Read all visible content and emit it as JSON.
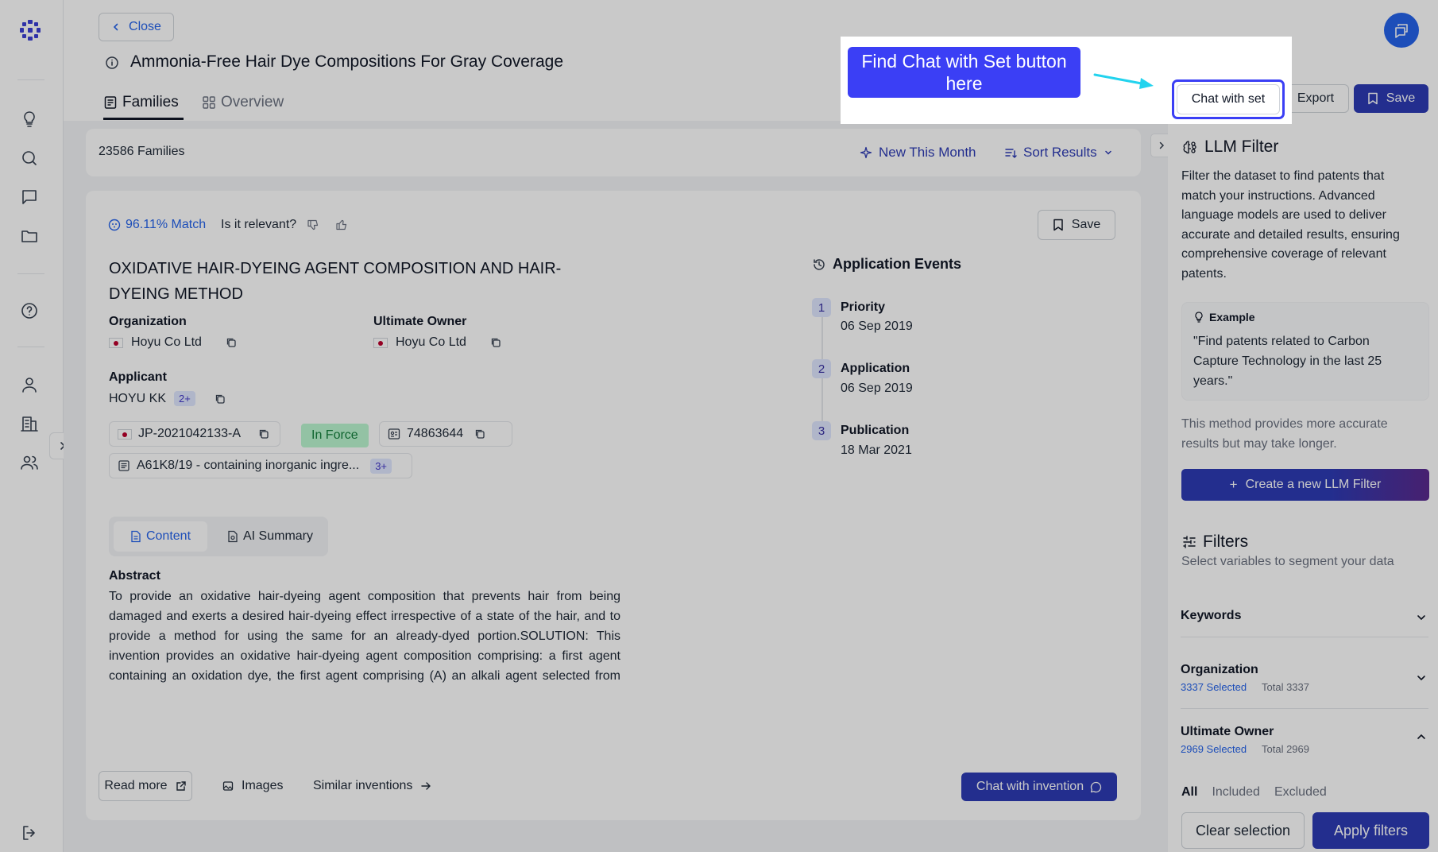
{
  "header": {
    "close_label": "Close",
    "title": "Ammonia-Free Hair Dye Compositions For Gray Coverage",
    "tabs": [
      {
        "label": "Families"
      },
      {
        "label": "Overview"
      }
    ],
    "export_label": "Export",
    "save_label": "Save",
    "chat_with_set_label": "Chat with set"
  },
  "annotation": {
    "text": "Find Chat with Set button here"
  },
  "results_bar": {
    "count_text": "23586 Families",
    "new_this_month": "New This Month",
    "sort_results": "Sort Results"
  },
  "result": {
    "match": "96.11% Match",
    "relevant_question": "Is it relevant?",
    "save_label": "Save",
    "title": "OXIDATIVE HAIR-DYEING AGENT COMPOSITION AND HAIR-DYEING METHOD",
    "organization_label": "Organization",
    "organization_value": "Hoyu Co Ltd",
    "ultimate_owner_label": "Ultimate Owner",
    "ultimate_owner_value": "Hoyu Co Ltd",
    "applicant_label": "Applicant",
    "applicant_value": "HOYU KK",
    "applicant_more": "2+",
    "publication_number": "JP-2021042133-A",
    "status": "In Force",
    "family_id": "74863644",
    "classification": "A61K8/19 - containing inorganic ingre...",
    "classification_more": "3+",
    "content_tabs": [
      {
        "label": "Content"
      },
      {
        "label": "AI Summary"
      }
    ],
    "abstract_label": "Abstract",
    "abstract_text": "To provide an oxidative hair-dyeing agent composition that prevents hair from being damaged and exerts a desired hair-dyeing effect irrespective of a state of the hair, and to provide a method for using the same for an already-dyed portion.SOLUTION: This invention provides an oxidative hair-dyeing agent composition comprising: a first agent containing an oxidation dye, the first agent comprising (A) an alkali agent selected from ammonia and/or alkanolamine, (B) the oxidation dye to which a sulfate or a hydrochloride is added, and (C) an ammonium salt, wherein alkalinity when used is 3.0 ml/g or less, and pH is 8.5-9.5; and a second agent containing an oxidant.SELECT...",
    "read_more": "Read more",
    "images": "Images",
    "similar_inventions": "Similar inventions",
    "chat_with_invention": "Chat with invention",
    "events_title": "Application Events",
    "events": [
      {
        "num": "1",
        "name": "Priority",
        "date": "06 Sep 2019"
      },
      {
        "num": "2",
        "name": "Application",
        "date": "06 Sep 2019"
      },
      {
        "num": "3",
        "name": "Publication",
        "date": "18 Mar 2021"
      }
    ]
  },
  "llm_filter": {
    "title": "LLM Filter",
    "description": "Filter the dataset to find patents that match your instructions. Advanced language models are used to deliver accurate and detailed results, ensuring comprehensive coverage of relevant patents.",
    "example_label": "Example",
    "example_text": "\"Find patents related to Carbon Capture Technology in the last 25 years.\"",
    "note": "This method provides more accurate results but may take longer.",
    "create_button": "Create a new LLM Filter"
  },
  "filters": {
    "title": "Filters",
    "subtitle": "Select variables to segment your data",
    "keywords": "Keywords",
    "organization": "Organization",
    "organization_selected": "3337 Selected",
    "organization_total": "Total 3337",
    "ultimate_owner": "Ultimate Owner",
    "ultimate_owner_selected": "2969 Selected",
    "ultimate_owner_total": "Total 2969",
    "segments": [
      "All",
      "Included",
      "Excluded"
    ],
    "clear_selection": "Clear selection",
    "apply_filters": "Apply filters"
  },
  "colors": {
    "primary": "#2d3bb5",
    "annotation_blue": "#3b3ff5",
    "link_blue": "#2563eb",
    "status_green": "#16a34a",
    "arrow_cyan": "#22d3ee"
  }
}
